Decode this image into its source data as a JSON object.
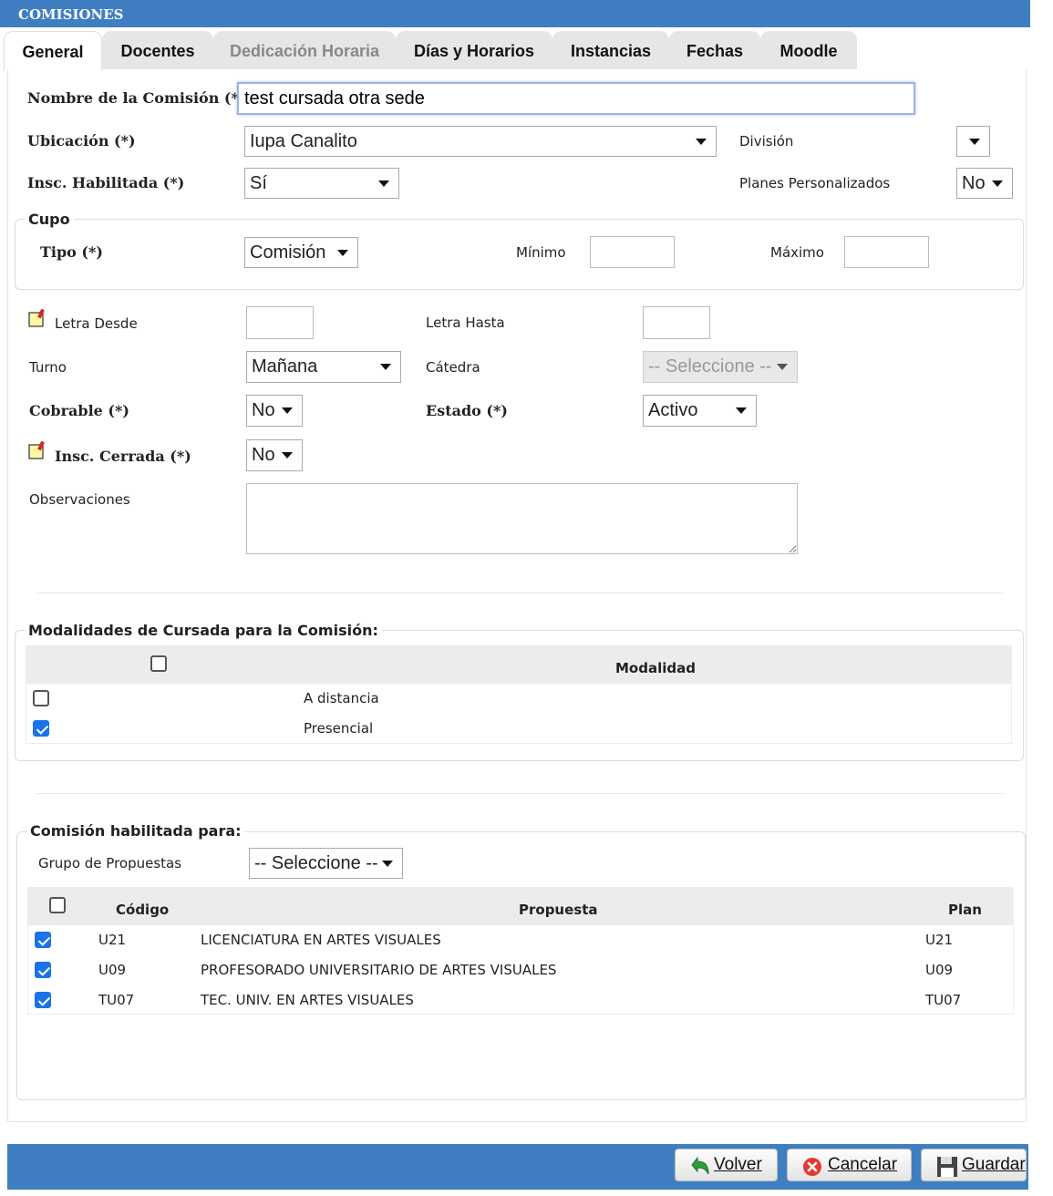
{
  "window": {
    "title": "COMISIONES"
  },
  "tabs": [
    {
      "label": "General",
      "active": true
    },
    {
      "label": "Docentes"
    },
    {
      "label": "Dedicación Horaria",
      "disabled": true
    },
    {
      "label": "Días y Horarios"
    },
    {
      "label": "Instancias"
    },
    {
      "label": "Fechas"
    },
    {
      "label": "Moodle"
    }
  ],
  "form": {
    "nombre_label": "Nombre de la Comisión (*)",
    "nombre_value": "test cursada otra sede",
    "ubicacion_label": "Ubicación (*)",
    "ubicacion_value": "Iupa Canalito",
    "division_label": "División",
    "division_value": "",
    "insc_habilitada_label": "Insc. Habilitada (*)",
    "insc_habilitada_value": "Sí",
    "planes_label": "Planes Personalizados",
    "planes_value": "No",
    "cupo_legend": "Cupo",
    "tipo_label": "Tipo (*)",
    "tipo_value": "Comisión",
    "minimo_label": "Mínimo",
    "minimo_value": "",
    "maximo_label": "Máximo",
    "maximo_value": "",
    "letra_desde_label": "Letra Desde",
    "letra_desde_value": "",
    "letra_hasta_label": "Letra Hasta",
    "letra_hasta_value": "",
    "turno_label": "Turno",
    "turno_value": "Mañana",
    "catedra_label": "Cátedra",
    "catedra_value": "-- Seleccione --",
    "cobrable_label": "Cobrable (*)",
    "cobrable_value": "No",
    "estado_label": "Estado (*)",
    "estado_value": "Activo",
    "insc_cerrada_label": "Insc. Cerrada (*)",
    "insc_cerrada_value": "No",
    "observaciones_label": "Observaciones",
    "observaciones_value": ""
  },
  "modalidades": {
    "legend": "Modalidades de Cursada para la Comisión:",
    "column": "Modalidad",
    "rows": [
      {
        "label": "A distancia",
        "checked": false
      },
      {
        "label": "Presencial",
        "checked": true
      }
    ]
  },
  "habilitada": {
    "legend": "Comisión habilitada para:",
    "grupo_label": "Grupo de Propuestas",
    "grupo_value": "-- Seleccione --",
    "columns": {
      "codigo": "Código",
      "propuesta": "Propuesta",
      "plan": "Plan"
    },
    "rows": [
      {
        "codigo": "U21",
        "propuesta": "LICENCIATURA EN ARTES VISUALES",
        "plan": "U21",
        "checked": true
      },
      {
        "codigo": "U09",
        "propuesta": "PROFESORADO UNIVERSITARIO DE ARTES VISUALES",
        "plan": "U09",
        "checked": true
      },
      {
        "codigo": "TU07",
        "propuesta": "TEC. UNIV. EN ARTES VISUALES",
        "plan": "TU07",
        "checked": true
      }
    ]
  },
  "footer": {
    "volver": "Volver",
    "cancelar": "Cancelar",
    "guardar": "Guardar"
  },
  "icons": {
    "volver": "green-arrow-back-icon",
    "cancelar": "red-x-icon",
    "guardar": "floppy-disk-icon",
    "note": "sticky-note-icon"
  },
  "colors": {
    "header": "#3f7fc1",
    "check": "#1a73e8"
  }
}
